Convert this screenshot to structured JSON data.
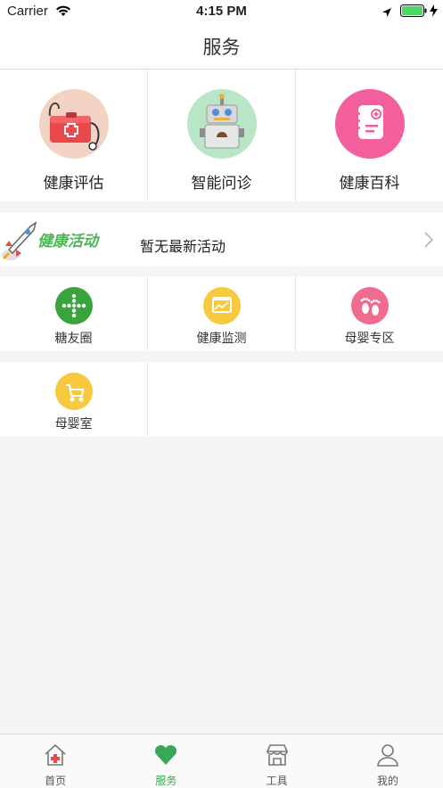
{
  "status_bar": {
    "carrier": "Carrier",
    "time": "4:15 PM"
  },
  "nav": {
    "title": "服务"
  },
  "top_services": [
    {
      "label": "健康评估",
      "icon": "medical-kit-icon",
      "color": "#f2d3c4"
    },
    {
      "label": "智能问诊",
      "icon": "robot-icon",
      "color": "#b8e6c6"
    },
    {
      "label": "健康百科",
      "icon": "encyclopedia-icon",
      "color": "#f25f9c"
    }
  ],
  "activity": {
    "logo_text": "健康活动",
    "message": "暂无最新活动"
  },
  "grid": [
    {
      "label": "糖友圈",
      "icon": "diabetes-circle-icon",
      "color": "#3aa33e"
    },
    {
      "label": "健康监测",
      "icon": "monitor-icon",
      "color": "#f7c93e"
    },
    {
      "label": "母婴专区",
      "icon": "baby-feet-icon",
      "color": "#f06b8e"
    },
    {
      "label": "母婴室",
      "icon": "stroller-icon",
      "color": "#f7c93e"
    }
  ],
  "tabs": [
    {
      "label": "首页",
      "icon": "home-icon"
    },
    {
      "label": "服务",
      "icon": "heart-icon",
      "active": true
    },
    {
      "label": "工具",
      "icon": "store-icon"
    },
    {
      "label": "我的",
      "icon": "user-icon"
    }
  ],
  "colors": {
    "accent": "#3aa757"
  }
}
